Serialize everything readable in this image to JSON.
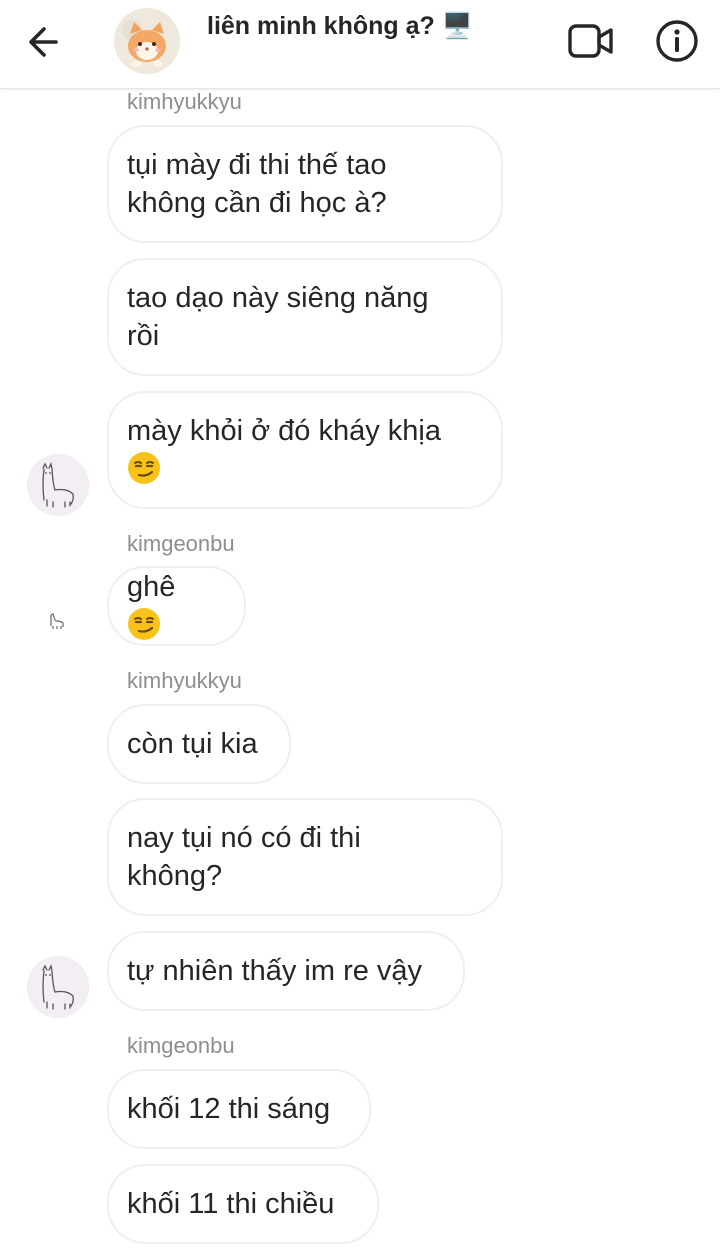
{
  "header": {
    "title": "liên minh không ạ? 🖥️",
    "back_icon": "arrow-left-icon",
    "video_icon": "video-camera-icon",
    "info_icon": "info-icon"
  },
  "colors": {
    "text": "#262626",
    "sender": "#8e8e8e",
    "bubble_border": "#efefef",
    "emoji_face": "#f9c21b"
  },
  "messages": [
    {
      "sender": "kimhyukkyu"
    },
    {
      "text": "tụi mày đi thi thế tao\nkhông cần đi học à?"
    },
    {
      "text": "tao dạo này siêng năng\nrồi"
    },
    {
      "text": "mày khỏi ở đó kháy khịa",
      "emoji": "smirk-emoji"
    },
    {
      "sender": "kimgeonbu"
    },
    {
      "text": "ghê",
      "emoji": "smirk-emoji"
    },
    {
      "sender": "kimhyukkyu"
    },
    {
      "text": "còn tụi kia"
    },
    {
      "text": "nay tụi nó có đi thi\nkhông?"
    },
    {
      "text": "tự nhiên thấy im re vậy"
    },
    {
      "sender": "kimgeonbu"
    },
    {
      "text": "khối 12 thi sáng"
    },
    {
      "text": "khối 11 thi chiều"
    }
  ]
}
